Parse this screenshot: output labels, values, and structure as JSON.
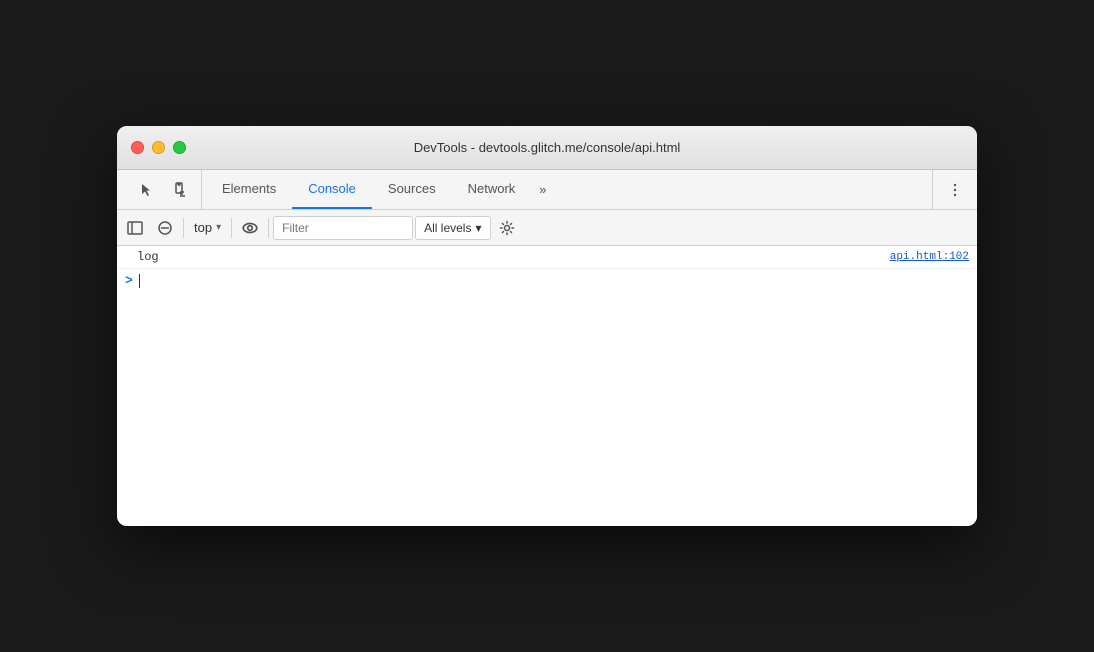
{
  "window": {
    "title": "DevTools - devtools.glitch.me/console/api.html"
  },
  "titlebar": {
    "buttons": {
      "close": "close",
      "minimize": "minimize",
      "maximize": "maximize"
    }
  },
  "tabs": [
    {
      "id": "elements",
      "label": "Elements",
      "active": false
    },
    {
      "id": "console",
      "label": "Console",
      "active": true
    },
    {
      "id": "sources",
      "label": "Sources",
      "active": false
    },
    {
      "id": "network",
      "label": "Network",
      "active": false
    }
  ],
  "tab_more_label": "»",
  "console_toolbar": {
    "context_value": "top",
    "filter_placeholder": "Filter",
    "levels_label": "All levels",
    "chevron": "▾"
  },
  "console_log": {
    "text": "log",
    "source": "api.html:102"
  },
  "console_input": {
    "prompt": ">"
  },
  "icons": {
    "sidebar_toggle": "sidebar-toggle-icon",
    "cursor": "cursor-icon",
    "device": "device-icon",
    "no_entry": "no-entry-icon",
    "eye": "eye-icon",
    "gear": "gear-icon",
    "more": "more-icon"
  },
  "colors": {
    "active_tab": "#1a73e8",
    "prompt_arrow": "#1a73e8",
    "log_source": "#1558d6"
  }
}
